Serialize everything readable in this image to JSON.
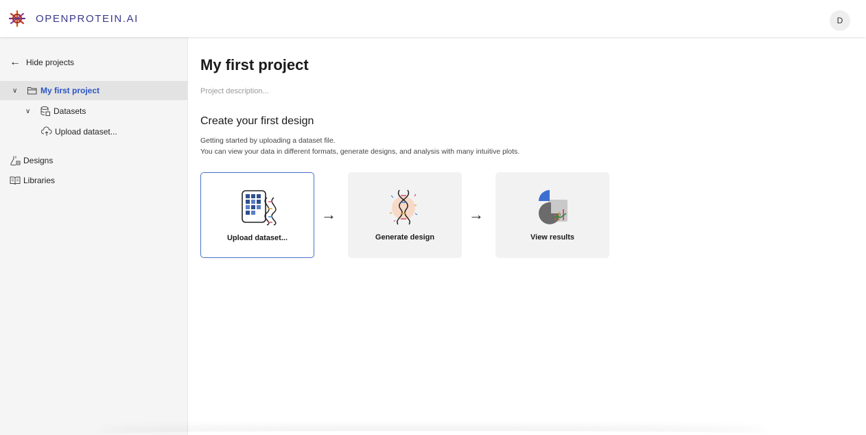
{
  "header": {
    "brand": "OPENPROTEIN.AI",
    "avatar_initial": "D"
  },
  "sidebar": {
    "hide_projects_label": "Hide projects",
    "project_label": "My first project",
    "datasets_label": "Datasets",
    "upload_dataset_label": "Upload dataset...",
    "designs_label": "Designs",
    "libraries_label": "Libraries"
  },
  "main": {
    "title": "My first project",
    "description_placeholder": "Project description...",
    "section_title": "Create your first design",
    "intro_line1": "Getting started by uploading a dataset file.",
    "intro_line2": "You can view your data in different formats, generate designs, and analysis with many intuitive plots.",
    "steps": [
      {
        "label": "Upload dataset...",
        "icon": "dataset-dna-icon"
      },
      {
        "label": "Generate design",
        "icon": "dna-generate-icon"
      },
      {
        "label": "View results",
        "icon": "chart-results-icon"
      }
    ]
  },
  "colors": {
    "accent": "#2b55c4",
    "brand": "#3a3a8c",
    "selected_border": "#4870c8"
  }
}
